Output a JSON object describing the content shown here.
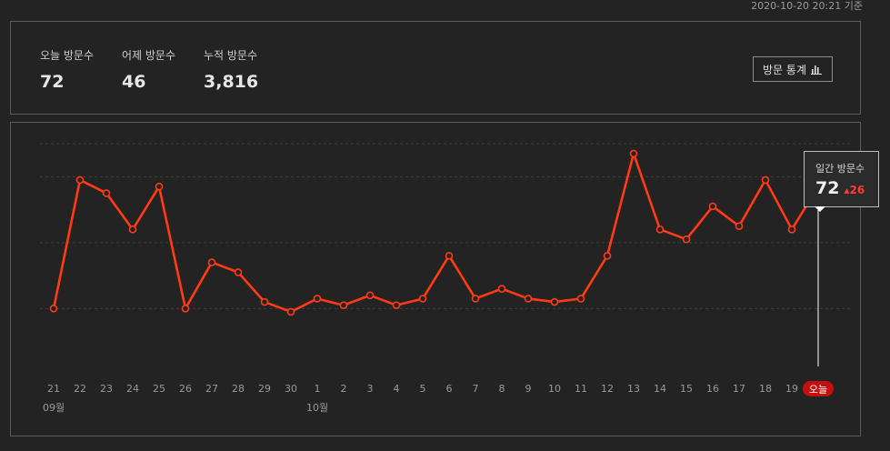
{
  "header": {
    "timestamp": "2020-10-20 20:21 기준"
  },
  "summary": {
    "today_label": "오늘 방문수",
    "today_value": "72",
    "yesterday_label": "어제 방문수",
    "yesterday_value": "46",
    "total_label": "누적 방문수",
    "total_value": "3,816",
    "stats_button_label": "방문 통계"
  },
  "tooltip": {
    "label": "일간 방문수",
    "value": "72",
    "delta": "26"
  },
  "colors": {
    "line": "#ff3a14",
    "today_badge": "#c40f0f",
    "background": "#232323",
    "grid": "#3e3e3e"
  },
  "chart_data": {
    "type": "line",
    "categories": [
      "21",
      "22",
      "23",
      "24",
      "25",
      "26",
      "27",
      "28",
      "29",
      "30",
      "1",
      "2",
      "3",
      "4",
      "5",
      "6",
      "7",
      "8",
      "9",
      "10",
      "11",
      "12",
      "13",
      "14",
      "15",
      "16",
      "17",
      "18",
      "19",
      "오늘"
    ],
    "month_labels": [
      {
        "index": 0,
        "text": "09월"
      },
      {
        "index": 10,
        "text": "10월"
      }
    ],
    "values": [
      35,
      74,
      70,
      59,
      72,
      35,
      49,
      46,
      37,
      34,
      38,
      36,
      39,
      36,
      38,
      51,
      38,
      41,
      38,
      37,
      38,
      51,
      82,
      59,
      56,
      66,
      60,
      74,
      59,
      72
    ],
    "ylim": [
      0,
      100
    ],
    "grid": true,
    "highlight_index": 29
  }
}
